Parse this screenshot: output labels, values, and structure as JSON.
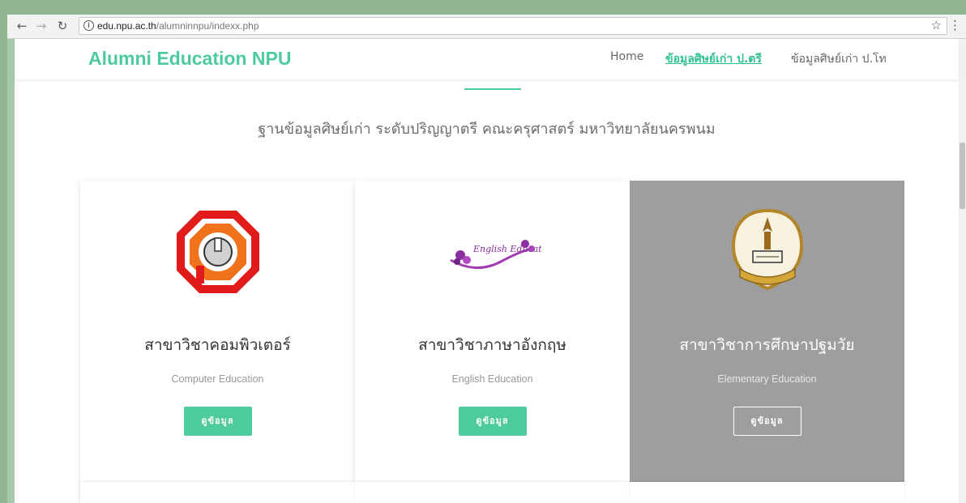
{
  "browser": {
    "url_domain": "edu.npu.ac.th",
    "url_path": "/alumninnpu/indexx.php",
    "back_icon": "arrow-left-icon",
    "forward_icon": "arrow-right-icon",
    "reload_icon": "reload-icon",
    "info_icon": "info-icon",
    "bookmark_icon": "star-icon",
    "menu_icon": "kebab-menu-icon"
  },
  "site": {
    "brand": "Alumni Education NPU",
    "accent_color": "#4ecb9c",
    "nav": [
      {
        "label": "Home",
        "active": false
      },
      {
        "label": "ข้อมูลศิษย์เก่า ป.ตรี",
        "active": true
      },
      {
        "label": "ข้อมูลศิษย์เก่า ป.โท",
        "active": false
      }
    ]
  },
  "main": {
    "headline": "ฐานข้อมูลศิษย์เก่า ระดับปริญญาตรี คณะครุศาสตร์ มหาวิทยาลัยนครพนม",
    "cards": [
      {
        "title": "สาขาวิชาคอมพิวเตอร์",
        "subtitle": "Computer Education",
        "button": "ดูข้อมูล",
        "logo": "computer-education-logo"
      },
      {
        "title": "สาขาวิชาภาษาอังกฤษ",
        "subtitle": "English Education",
        "button": "ดูข้อมูล",
        "logo": "english-education-logo",
        "logo_text": "English Education"
      },
      {
        "title": "สาขาวิชาการศึกษาปฐมวัย",
        "subtitle": "Elementary Education",
        "button": "ดูข้อมูล",
        "logo": "faculty-of-education-seal",
        "highlighted": true
      }
    ]
  }
}
